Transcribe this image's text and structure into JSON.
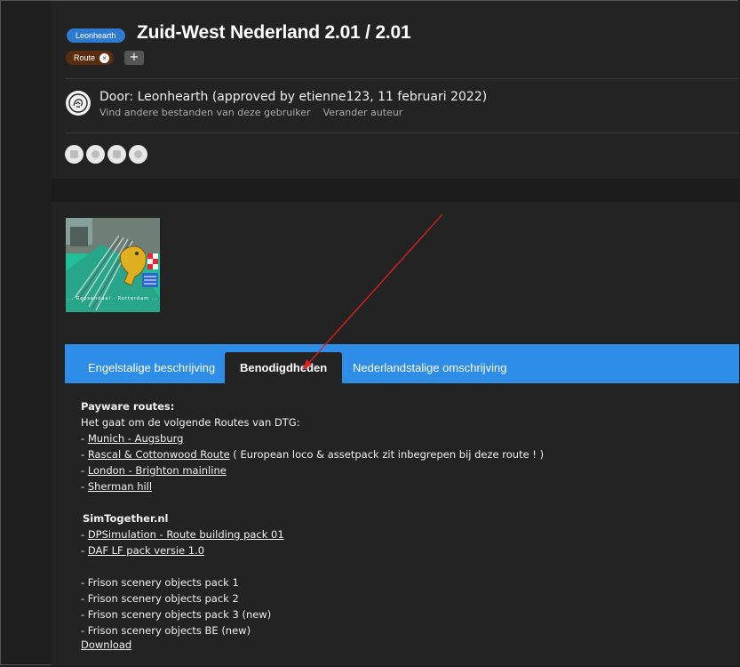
{
  "header": {
    "author_badge": "Leonhearth",
    "title": "Zuid-West Nederland 2.01 / 2.01",
    "tag": "Route",
    "tag_remove": "×",
    "add_tag": "+"
  },
  "author": {
    "byline": "Door: Leonhearth (approved by etienne123, 11 februari 2022)",
    "link_other_files": "Vind andere bestanden van deze gebruiker",
    "link_change_author": "Verander auteur"
  },
  "social_icons": [
    "share-icon-1",
    "share-icon-2",
    "share-icon-3",
    "share-icon-4"
  ],
  "thumbnail_caption": "... Roosendaal · Rotterdam ...",
  "tabs": [
    {
      "label": "Engelstalige beschrijving"
    },
    {
      "label": "Benodigdheden",
      "active": true
    },
    {
      "label": "Nederlandstalige omschrijving"
    }
  ],
  "content": {
    "payware_heading": "Payware routes:",
    "intro": "Het gaat om de volgende Routes van DTG:",
    "dash": "- ",
    "route1": "Munich - Augsburg",
    "route2": "Rascal & Cottonwood Route",
    "route2_note": " ( European loco & assetpack zit inbegrepen bij deze route ! )",
    "route3": "London - Brighton mainline",
    "route4": "Sherman hill ",
    "simtogether_heading": "SimTogether.nl",
    "st1": "DPSimulation - Route building pack 01",
    "st2": "DAF LF pack versie 1.0",
    "frison1": "- Frison scenery objects pack 1",
    "frison2": "- Frison scenery objects pack 2",
    "frison3": "- Frison scenery objects pack 3 (new)",
    "frison4": "- Frison scenery objects BE (new)",
    "download": "Download"
  },
  "colors": {
    "accent": "#2e8de6",
    "badge": "#2e7ad1",
    "tag": "#5a2d0f",
    "arrow": "#e02020",
    "panel": "#232323",
    "background": "#1e1e1e"
  }
}
